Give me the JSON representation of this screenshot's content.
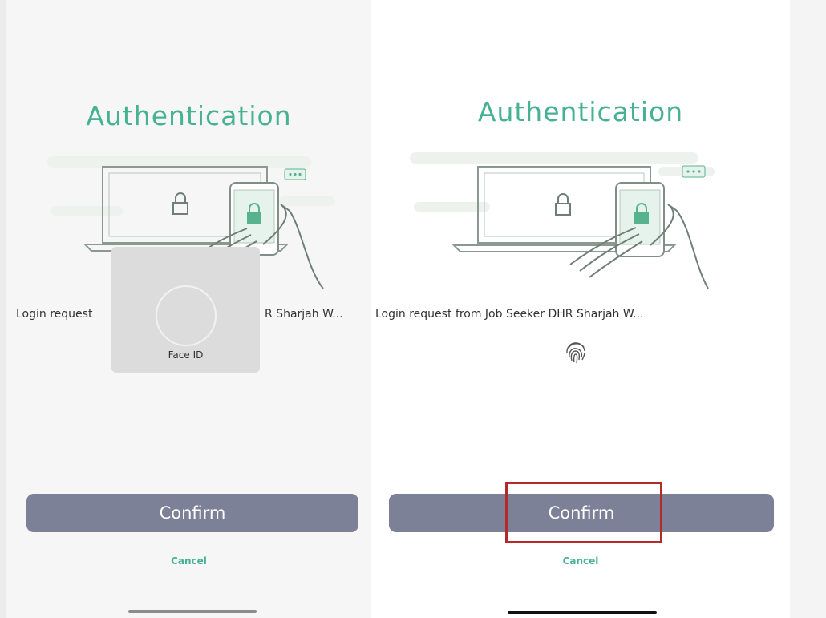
{
  "left": {
    "title": "Authentication",
    "login_text_start": "Login request",
    "login_text_end": "R Sharjah W...",
    "face_id_label": "Face ID",
    "confirm_label": "Confirm",
    "cancel_label": "Cancel"
  },
  "right": {
    "title": "Authentication",
    "login_text": "Login request from Job Seeker DHR Sharjah W...",
    "confirm_label": "Confirm",
    "cancel_label": "Cancel"
  },
  "icons": {
    "illustration": "laptop-phone-lock-illustration",
    "fingerprint": "fingerprint-icon",
    "face_id": "face-id-icon"
  },
  "colors": {
    "accent": "#47b293",
    "button": "#7c8197",
    "highlight": "#b22a2a"
  }
}
